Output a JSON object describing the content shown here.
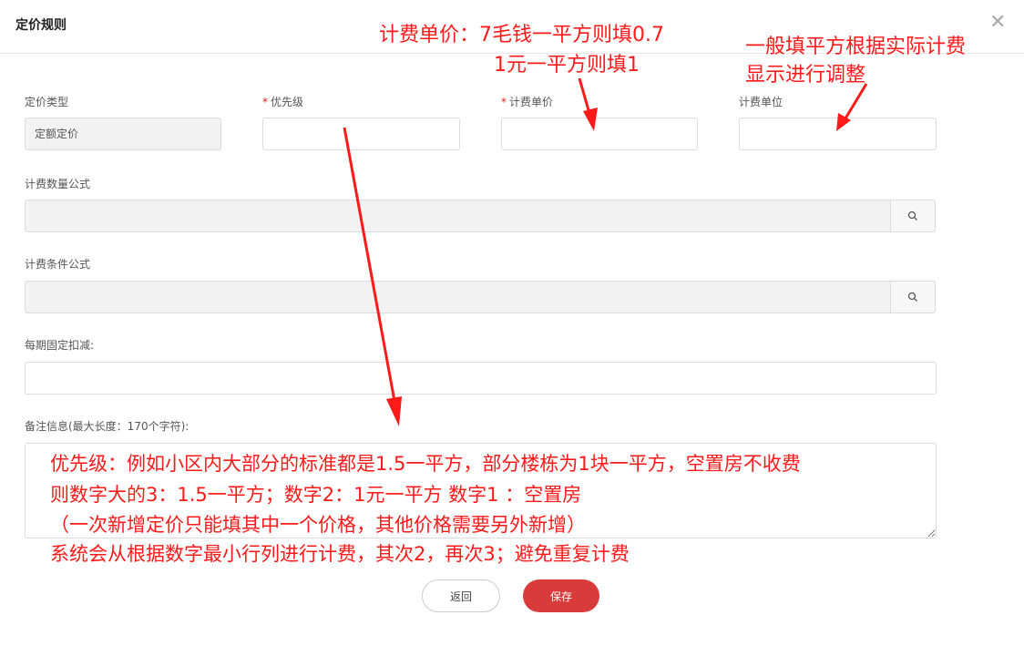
{
  "dialog": {
    "title": "定价规则"
  },
  "form": {
    "pricing_type": {
      "label": "定价类型",
      "value": "定额定价"
    },
    "priority": {
      "label": "优先级",
      "required": true,
      "value": ""
    },
    "unit_price": {
      "label": "计费单价",
      "required": true,
      "value": ""
    },
    "unit": {
      "label": "计费单位",
      "value": ""
    },
    "quantity_formula": {
      "label": "计费数量公式",
      "value": ""
    },
    "condition_formula": {
      "label": "计费条件公式",
      "value": ""
    },
    "fixed_deduction": {
      "label": "每期固定扣减:",
      "value": ""
    },
    "remarks": {
      "label": "备注信息(最大长度：170个字符):",
      "value": ""
    },
    "required_mark": "*"
  },
  "buttons": {
    "back": "返回",
    "save": "保存"
  },
  "annotations": {
    "unit_price_note_1": "计费单价：7毛钱一平方则填0.7",
    "unit_price_note_2": "1元一平方则填1",
    "unit_note_1": "一般填平方根据实际计费",
    "unit_note_2": "显示进行调整",
    "priority_note_1": "优先级：例如小区内大部分的标准都是1.5一平方，部分楼栋为1块一平方，空置房不收费",
    "priority_note_2": "则数字大的3：1.5一平方；数字2：1元一平方  数字1 ：空置房",
    "priority_note_3": "（一次新增定价只能填其中一个价格，其他价格需要另外新增）",
    "priority_note_4": "系统会从根据数字最小行列进行计费，其次2，再次3；避免重复计费"
  },
  "colors": {
    "annotation": "#ff1a1a",
    "save_button": "#d93a3a",
    "required": "#e02020"
  },
  "icons": {
    "close": "close-icon",
    "search": "search-icon"
  }
}
